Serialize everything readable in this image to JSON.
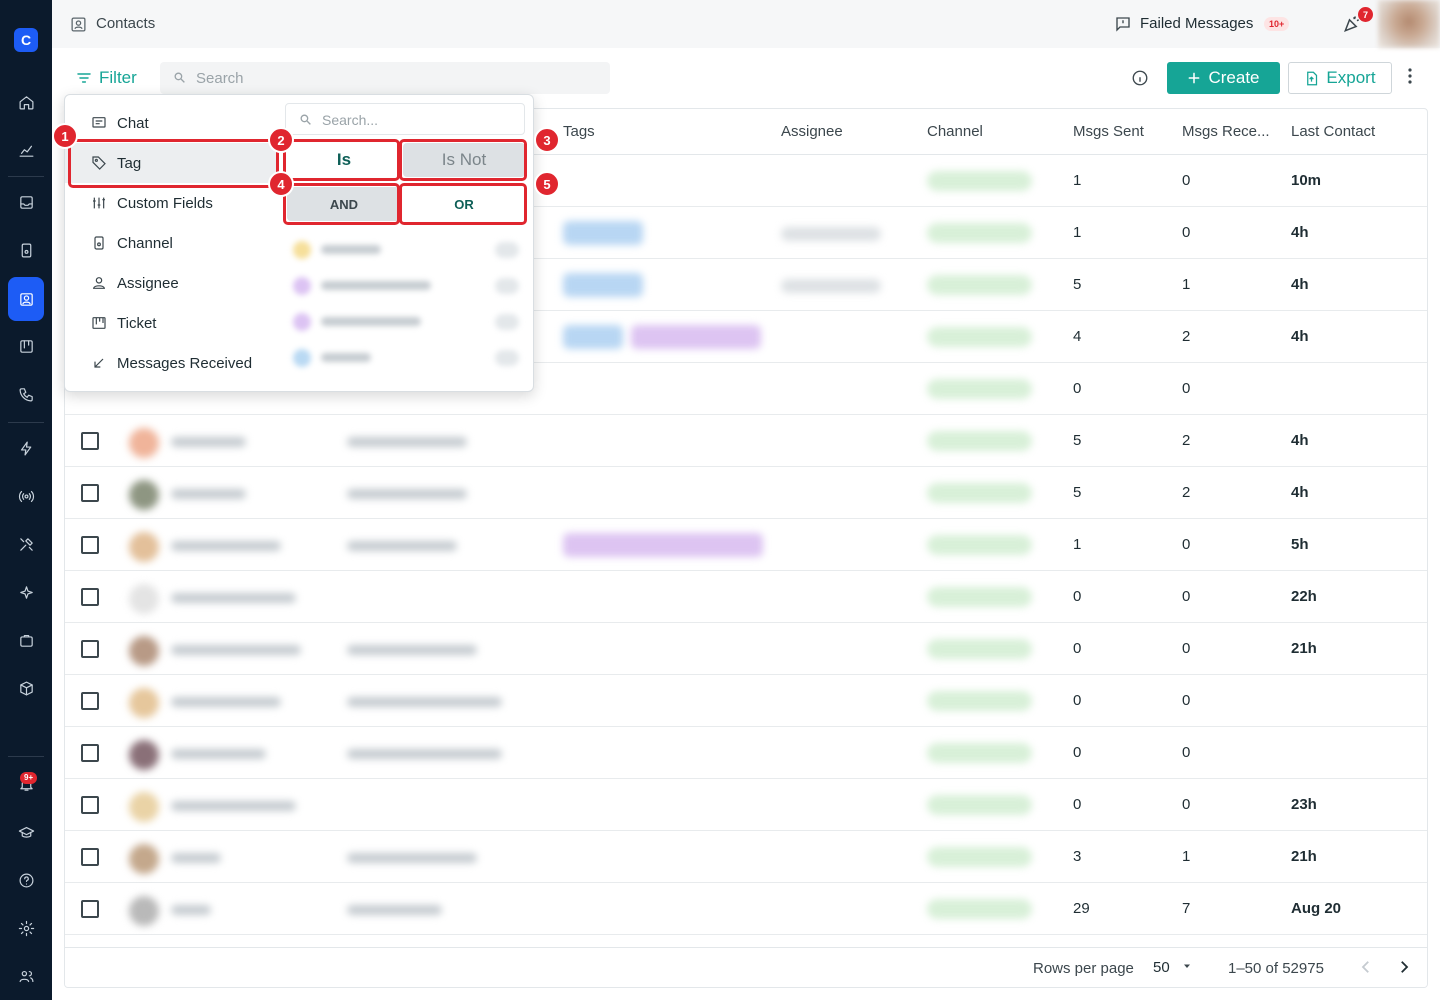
{
  "header": {
    "title": "Contacts",
    "failed_messages_label": "Failed Messages",
    "failed_messages_badge": "10+",
    "notification_badge": "7"
  },
  "sidebar": {
    "logo_letter": "C",
    "notification_badge": "9+",
    "items": [
      {
        "icon": "home-icon",
        "active": false
      },
      {
        "icon": "chart-icon",
        "active": false
      },
      {
        "icon": "inbox-icon",
        "active": false
      },
      {
        "icon": "phone-device-icon",
        "active": false
      },
      {
        "icon": "contacts-icon",
        "active": true
      },
      {
        "icon": "board-icon",
        "active": false
      },
      {
        "icon": "call-icon",
        "active": false
      },
      {
        "icon": "lightning-icon",
        "active": false
      },
      {
        "icon": "broadcast-icon",
        "active": false
      },
      {
        "icon": "tools-icon",
        "active": false
      },
      {
        "icon": "sparkle-icon",
        "active": false
      },
      {
        "icon": "briefcase-icon",
        "active": false
      },
      {
        "icon": "package-icon",
        "active": false
      },
      {
        "icon": "bell-icon",
        "active": false
      },
      {
        "icon": "academy-icon",
        "active": false
      },
      {
        "icon": "help-icon",
        "active": false
      },
      {
        "icon": "settings-icon",
        "active": false
      },
      {
        "icon": "team-icon",
        "active": false
      }
    ]
  },
  "toolbar": {
    "filter_label": "Filter",
    "search_placeholder": "Search",
    "create_label": "Create",
    "export_label": "Export"
  },
  "filter_menu": {
    "search_placeholder": "Search...",
    "items": [
      "Chat",
      "Tag",
      "Custom Fields",
      "Channel",
      "Assignee",
      "Ticket",
      "Messages Received"
    ],
    "selected_item": "Tag",
    "op_is": "Is",
    "op_is_not": "Is Not",
    "op_and": "AND",
    "op_or": "OR"
  },
  "annotations": [
    "1",
    "2",
    "3",
    "4",
    "5"
  ],
  "table": {
    "columns": [
      "Tags",
      "Assignee",
      "Channel",
      "Msgs Sent",
      "Msgs Rece...",
      "Last Contact"
    ],
    "rows": [
      {
        "sent": "1",
        "received": "0",
        "last": "10m"
      },
      {
        "sent": "1",
        "received": "0",
        "last": "4h"
      },
      {
        "sent": "5",
        "received": "1",
        "last": "4h"
      },
      {
        "sent": "4",
        "received": "2",
        "last": "4h"
      },
      {
        "sent": "0",
        "received": "0",
        "last": ""
      },
      {
        "sent": "5",
        "received": "2",
        "last": "4h"
      },
      {
        "sent": "5",
        "received": "2",
        "last": "4h"
      },
      {
        "sent": "1",
        "received": "0",
        "last": "5h"
      },
      {
        "sent": "0",
        "received": "0",
        "last": "22h"
      },
      {
        "sent": "0",
        "received": "0",
        "last": "21h"
      },
      {
        "sent": "0",
        "received": "0",
        "last": ""
      },
      {
        "sent": "0",
        "received": "0",
        "last": ""
      },
      {
        "sent": "0",
        "received": "0",
        "last": "23h"
      },
      {
        "sent": "3",
        "received": "1",
        "last": "21h"
      },
      {
        "sent": "29",
        "received": "7",
        "last": "Aug 20"
      }
    ]
  },
  "pagination": {
    "rows_per_page_label": "Rows per page",
    "rows_per_page": "50",
    "range": "1–50 of 52975"
  },
  "colors": {
    "accent": "#16a596",
    "sidebar_bg": "#0b1a2c",
    "active_nav": "#1d5cf5",
    "annotation": "#e0262f"
  }
}
